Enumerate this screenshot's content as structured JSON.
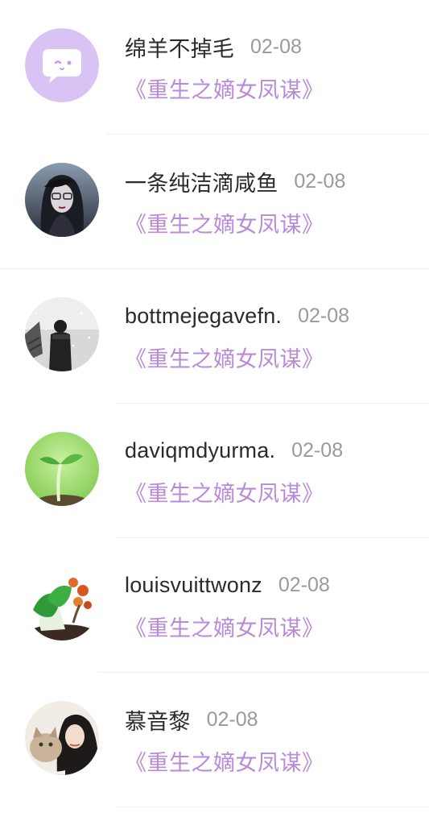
{
  "comments": [
    {
      "name": "绵羊不掉毛",
      "date": "02-08",
      "book": "《重生之嫡女凤谋》",
      "avatar": "default-chat-avatar"
    },
    {
      "name": "一条纯洁滴咸鱼",
      "date": "02-08",
      "book": "《重生之嫡女凤谋》",
      "avatar": "dark-hair-girl-avatar"
    },
    {
      "name": "bottmejegavefn.",
      "date": "02-08",
      "book": "《重生之嫡女凤谋》",
      "avatar": "snow-walker-avatar"
    },
    {
      "name": "daviqmdyurma.",
      "date": "02-08",
      "book": "《重生之嫡女凤谋》",
      "avatar": "sprout-avatar"
    },
    {
      "name": "louisvuittwonz",
      "date": "02-08",
      "book": "《重生之嫡女凤谋》",
      "avatar": "jade-cabbage-avatar"
    },
    {
      "name": "慕音黎",
      "date": "02-08",
      "book": "《重生之嫡女凤谋》",
      "avatar": "girl-with-cat-avatar"
    }
  ],
  "colors": {
    "accent": "#b88ad8",
    "name_text": "#2b2b2b",
    "date_text": "#9a9a9a",
    "default_avatar_bg": "#d9c3f5"
  }
}
